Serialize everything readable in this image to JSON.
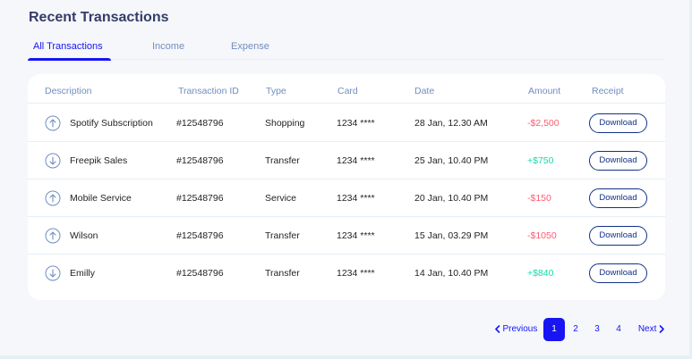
{
  "title": "Recent Transactions",
  "tabs": [
    {
      "label": "All Transactions",
      "active": true
    },
    {
      "label": "Income",
      "active": false
    },
    {
      "label": "Expense",
      "active": false
    }
  ],
  "table": {
    "headers": [
      "Description",
      "Transaction ID",
      "Type",
      "Card",
      "Date",
      "Amount",
      "Receipt"
    ],
    "rows": [
      {
        "direction": "up",
        "description": "Spotify Subscription",
        "id": "#12548796",
        "type": "Shopping",
        "card": "1234 ****",
        "date": "28 Jan, 12.30 AM",
        "amount": "-$2,500",
        "amount_sign": "negative",
        "receipt": "Download"
      },
      {
        "direction": "down",
        "description": "Freepik Sales",
        "id": "#12548796",
        "type": "Transfer",
        "card": "1234 ****",
        "date": "25 Jan, 10.40 PM",
        "amount": "+$750",
        "amount_sign": "positive",
        "receipt": "Download"
      },
      {
        "direction": "up",
        "description": "Mobile Service",
        "id": "#12548796",
        "type": "Service",
        "card": "1234 ****",
        "date": "20 Jan, 10.40 PM",
        "amount": "-$150",
        "amount_sign": "negative",
        "receipt": "Download"
      },
      {
        "direction": "up",
        "description": "Wilson",
        "id": "#12548796",
        "type": "Transfer",
        "card": "1234 ****",
        "date": "15 Jan, 03.29 PM",
        "amount": "-$1050",
        "amount_sign": "negative",
        "receipt": "Download"
      },
      {
        "direction": "down",
        "description": "Emilly",
        "id": "#12548796",
        "type": "Transfer",
        "card": "1234 ****",
        "date": "14 Jan, 10.40 PM",
        "amount": "+$840",
        "amount_sign": "positive",
        "receipt": "Download"
      }
    ]
  },
  "pagination": {
    "previous": "Previous",
    "pages": [
      "1",
      "2",
      "3",
      "4"
    ],
    "current": "1",
    "next": "Next"
  },
  "colors": {
    "accent": "#1814f3",
    "negative": "#fe5c73",
    "positive": "#16dbaa",
    "muted": "#718ebf"
  }
}
